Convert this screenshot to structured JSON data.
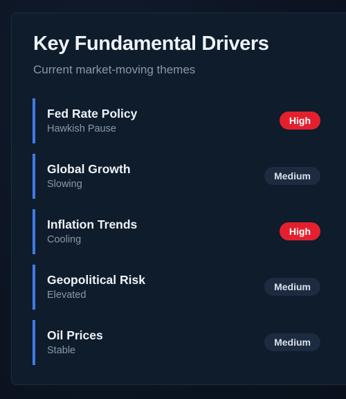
{
  "panel": {
    "title": "Key Fundamental Drivers",
    "subtitle": "Current market-moving themes"
  },
  "colors": {
    "accent_bar": "#3f7be6",
    "high_badge": "#e5202e",
    "medium_badge": "#1c2b3f"
  },
  "drivers": [
    {
      "name": "Fed Rate Policy",
      "status": "Hawkish Pause",
      "impact": "High",
      "level": "high"
    },
    {
      "name": "Global Growth",
      "status": "Slowing",
      "impact": "Medium",
      "level": "medium"
    },
    {
      "name": "Inflation Trends",
      "status": "Cooling",
      "impact": "High",
      "level": "high"
    },
    {
      "name": "Geopolitical Risk",
      "status": "Elevated",
      "impact": "Medium",
      "level": "medium"
    },
    {
      "name": "Oil Prices",
      "status": "Stable",
      "impact": "Medium",
      "level": "medium"
    }
  ]
}
